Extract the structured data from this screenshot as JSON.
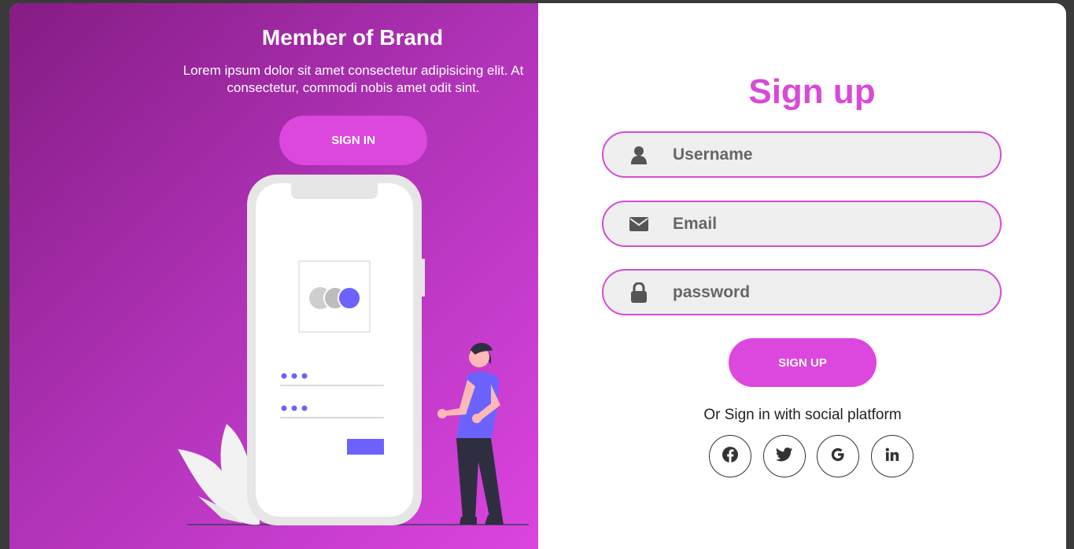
{
  "left_panel": {
    "title": "Member of Brand",
    "description": "Lorem ipsum dolor sit amet consectetur adipisicing elit. At consectetur, commodi nobis amet odit sint.",
    "signin_label": "SIGN IN"
  },
  "form": {
    "title": "Sign up",
    "username_placeholder": "Username",
    "email_placeholder": "Email",
    "password_placeholder": "password",
    "submit_label": "SIGN UP",
    "social_text": "Or Sign in with social platform"
  },
  "social_icons": [
    "facebook-icon",
    "twitter-icon",
    "google-icon",
    "linkedin-icon"
  ],
  "colors": {
    "accent": "#dc47dd",
    "title": "#d949d9",
    "gradient_start": "#861c84",
    "gradient_end": "#db44e0",
    "illustration_accent": "#6c63ff"
  }
}
